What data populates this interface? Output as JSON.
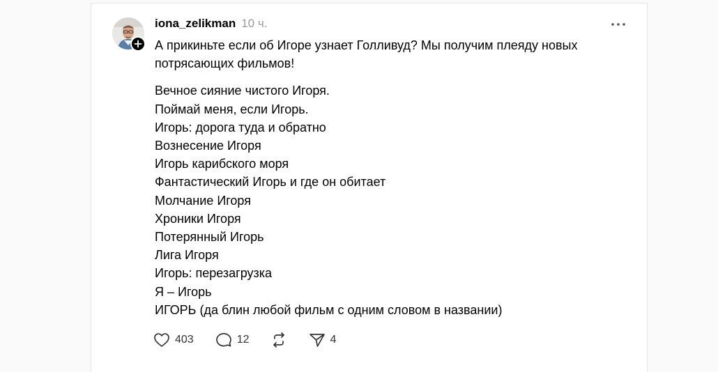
{
  "post": {
    "username": "iona_zelikman",
    "time": "10 ч.",
    "intro": "А прикиньте если об Игоре узнает Голливуд? Мы получим плеяду новых потрясающих фильмов!",
    "lines": [
      "Вечное сияние чистого Игоря.",
      "Поймай меня, если Игорь.",
      "Игорь: дорога туда и обратно",
      "Вознесение Игоря",
      "Игорь карибского моря",
      "Фантастический Игорь и где он обитает",
      "Молчание Игоря",
      "Хроники Игоря",
      "Потерянный Игорь",
      "Лига Игоря",
      "Игорь: перезагрузка",
      "Я – Игорь",
      "ИГОРЬ (да блин любой фильм с одним словом в названии)"
    ],
    "actions": {
      "likes": "403",
      "replies": "12",
      "shares": "4"
    },
    "icons": {
      "more": "more-horizontal-icon",
      "follow": "plus-icon",
      "like": "heart-icon",
      "reply": "comment-icon",
      "repost": "repost-icon",
      "share": "send-icon"
    }
  }
}
